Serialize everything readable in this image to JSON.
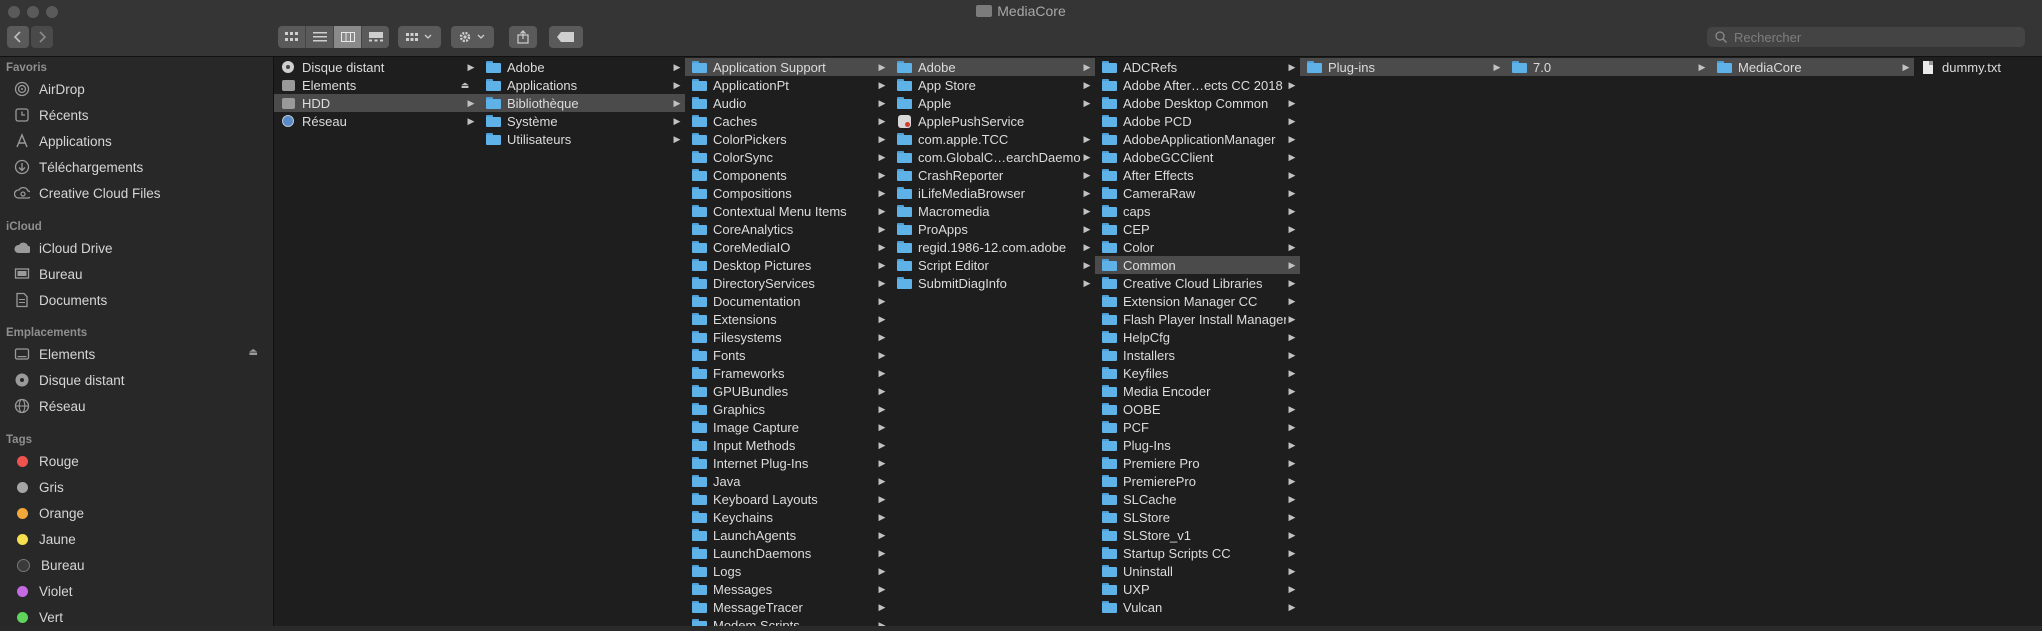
{
  "window": {
    "title": "MediaCore"
  },
  "toolbar": {
    "back_icon": "chevron-left-icon",
    "forward_icon": "chevron-right-icon",
    "views": [
      "icon-view-icon",
      "list-view-icon",
      "column-view-icon",
      "gallery-view-icon"
    ],
    "active_view": 2,
    "search_placeholder": "Rechercher"
  },
  "sidebar": {
    "sections": [
      {
        "title": "Favoris",
        "items": [
          {
            "label": "AirDrop",
            "icon": "airdrop-icon"
          },
          {
            "label": "Récents",
            "icon": "clock-icon"
          },
          {
            "label": "Applications",
            "icon": "applications-icon"
          },
          {
            "label": "Téléchargements",
            "icon": "download-icon"
          },
          {
            "label": "Creative Cloud Files",
            "icon": "creative-cloud-icon"
          }
        ]
      },
      {
        "title": "iCloud",
        "items": [
          {
            "label": "iCloud Drive",
            "icon": "cloud-icon"
          },
          {
            "label": "Bureau",
            "icon": "desktop-icon"
          },
          {
            "label": "Documents",
            "icon": "document-icon"
          }
        ]
      },
      {
        "title": "Emplacements",
        "items": [
          {
            "label": "Elements",
            "icon": "drive-icon",
            "eject": true
          },
          {
            "label": "Disque distant",
            "icon": "disc-icon"
          },
          {
            "label": "Réseau",
            "icon": "network-icon"
          }
        ]
      },
      {
        "title": "Tags",
        "items": [
          {
            "label": "Rouge",
            "color": "#ef5350"
          },
          {
            "label": "Gris",
            "color": "#a5a5a5"
          },
          {
            "label": "Orange",
            "color": "#f5a83a"
          },
          {
            "label": "Jaune",
            "color": "#f4e04d"
          },
          {
            "label": "Bureau",
            "color": "#3a3a3a"
          },
          {
            "label": "Violet",
            "color": "#c46be3"
          },
          {
            "label": "Vert",
            "color": "#5fd35b"
          }
        ]
      }
    ]
  },
  "columns": [
    {
      "items": [
        {
          "label": "Disque distant",
          "icon": "disc",
          "arrow": true
        },
        {
          "label": "Elements",
          "icon": "drive",
          "eject": true
        },
        {
          "label": "HDD",
          "icon": "drive",
          "arrow": true,
          "selected": true
        },
        {
          "label": "Réseau",
          "icon": "globe",
          "arrow": true
        }
      ]
    },
    {
      "items": [
        {
          "label": "Adobe",
          "arrow": true
        },
        {
          "label": "Applications",
          "arrow": true
        },
        {
          "label": "Bibliothèque",
          "arrow": true,
          "selected": true
        },
        {
          "label": "Système",
          "arrow": true
        },
        {
          "label": "Utilisateurs",
          "arrow": true
        }
      ]
    },
    {
      "items": [
        {
          "label": "Application Support",
          "arrow": true,
          "selected": true
        },
        {
          "label": "ApplicationPt",
          "arrow": true
        },
        {
          "label": "Audio",
          "arrow": true
        },
        {
          "label": "Caches",
          "arrow": true
        },
        {
          "label": "ColorPickers",
          "arrow": true
        },
        {
          "label": "ColorSync",
          "arrow": true
        },
        {
          "label": "Components",
          "arrow": true
        },
        {
          "label": "Compositions",
          "arrow": true
        },
        {
          "label": "Contextual Menu Items",
          "arrow": true
        },
        {
          "label": "CoreAnalytics",
          "arrow": true
        },
        {
          "label": "CoreMediaIO",
          "arrow": true
        },
        {
          "label": "Desktop Pictures",
          "arrow": true
        },
        {
          "label": "DirectoryServices",
          "arrow": true
        },
        {
          "label": "Documentation",
          "arrow": true
        },
        {
          "label": "Extensions",
          "arrow": true
        },
        {
          "label": "Filesystems",
          "arrow": true
        },
        {
          "label": "Fonts",
          "arrow": true
        },
        {
          "label": "Frameworks",
          "arrow": true
        },
        {
          "label": "GPUBundles",
          "arrow": true
        },
        {
          "label": "Graphics",
          "arrow": true
        },
        {
          "label": "Image Capture",
          "arrow": true
        },
        {
          "label": "Input Methods",
          "arrow": true
        },
        {
          "label": "Internet Plug-Ins",
          "arrow": true
        },
        {
          "label": "Java",
          "arrow": true
        },
        {
          "label": "Keyboard Layouts",
          "arrow": true
        },
        {
          "label": "Keychains",
          "arrow": true
        },
        {
          "label": "LaunchAgents",
          "arrow": true
        },
        {
          "label": "LaunchDaemons",
          "arrow": true
        },
        {
          "label": "Logs",
          "arrow": true
        },
        {
          "label": "Messages",
          "arrow": true
        },
        {
          "label": "MessageTracer",
          "arrow": true
        },
        {
          "label": "Modem Scripts",
          "arrow": true
        }
      ]
    },
    {
      "items": [
        {
          "label": "Adobe",
          "arrow": true,
          "selected": true
        },
        {
          "label": "App Store",
          "arrow": true
        },
        {
          "label": "Apple",
          "arrow": true
        },
        {
          "label": "ApplePushService",
          "icon": "app"
        },
        {
          "label": "com.apple.TCC",
          "arrow": true
        },
        {
          "label": "com.GlobalC…earchDaemon",
          "arrow": true
        },
        {
          "label": "CrashReporter",
          "arrow": true
        },
        {
          "label": "iLifeMediaBrowser",
          "arrow": true
        },
        {
          "label": "Macromedia",
          "arrow": true
        },
        {
          "label": "ProApps",
          "arrow": true
        },
        {
          "label": "regid.1986-12.com.adobe",
          "arrow": true
        },
        {
          "label": "Script Editor",
          "arrow": true
        },
        {
          "label": "SubmitDiagInfo",
          "arrow": true
        }
      ]
    },
    {
      "items": [
        {
          "label": "ADCRefs",
          "arrow": true
        },
        {
          "label": "Adobe After…ects CC 2018",
          "arrow": true
        },
        {
          "label": "Adobe Desktop Common",
          "arrow": true
        },
        {
          "label": "Adobe PCD",
          "arrow": true
        },
        {
          "label": "AdobeApplicationManager",
          "arrow": true
        },
        {
          "label": "AdobeGCClient",
          "arrow": true
        },
        {
          "label": "After Effects",
          "arrow": true
        },
        {
          "label": "CameraRaw",
          "arrow": true
        },
        {
          "label": "caps",
          "arrow": true
        },
        {
          "label": "CEP",
          "arrow": true
        },
        {
          "label": "Color",
          "arrow": true
        },
        {
          "label": "Common",
          "arrow": true,
          "selected": true
        },
        {
          "label": "Creative Cloud Libraries",
          "arrow": true
        },
        {
          "label": "Extension Manager CC",
          "arrow": true
        },
        {
          "label": "Flash Player Install Manager",
          "arrow": true
        },
        {
          "label": "HelpCfg",
          "arrow": true
        },
        {
          "label": "Installers",
          "arrow": true
        },
        {
          "label": "Keyfiles",
          "arrow": true
        },
        {
          "label": "Media Encoder",
          "arrow": true
        },
        {
          "label": "OOBE",
          "arrow": true
        },
        {
          "label": "PCF",
          "arrow": true
        },
        {
          "label": "Plug-Ins",
          "arrow": true
        },
        {
          "label": "Premiere Pro",
          "arrow": true
        },
        {
          "label": "PremierePro",
          "arrow": true
        },
        {
          "label": "SLCache",
          "arrow": true
        },
        {
          "label": "SLStore",
          "arrow": true
        },
        {
          "label": "SLStore_v1",
          "arrow": true
        },
        {
          "label": "Startup Scripts CC",
          "arrow": true
        },
        {
          "label": "Uninstall",
          "arrow": true
        },
        {
          "label": "UXP",
          "arrow": true
        },
        {
          "label": "Vulcan",
          "arrow": true
        }
      ]
    },
    {
      "items": [
        {
          "label": "Plug-ins",
          "arrow": true,
          "selected": true
        }
      ]
    },
    {
      "items": [
        {
          "label": "7.0",
          "arrow": true,
          "selected": true
        }
      ]
    },
    {
      "items": [
        {
          "label": "MediaCore",
          "arrow": true,
          "selected": true
        }
      ]
    },
    {
      "items": [
        {
          "label": "dummy.txt",
          "icon": "file"
        }
      ]
    }
  ]
}
